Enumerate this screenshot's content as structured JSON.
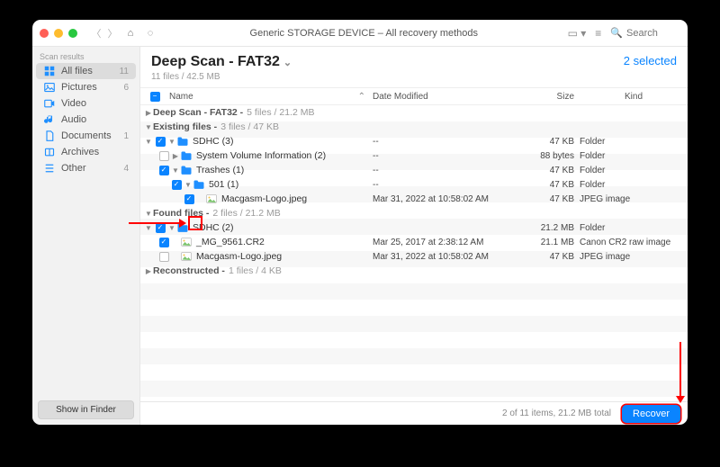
{
  "toolbar": {
    "title": "Generic STORAGE DEVICE – All recovery methods",
    "search_placeholder": "Search"
  },
  "sidebar": {
    "heading": "Scan results",
    "items": [
      {
        "label": "All files",
        "count": "11",
        "active": true,
        "icon": "grid"
      },
      {
        "label": "Pictures",
        "count": "6",
        "icon": "picture"
      },
      {
        "label": "Video",
        "count": "",
        "icon": "video"
      },
      {
        "label": "Audio",
        "count": "",
        "icon": "audio"
      },
      {
        "label": "Documents",
        "count": "1",
        "icon": "document"
      },
      {
        "label": "Archives",
        "count": "",
        "icon": "archive"
      },
      {
        "label": "Other",
        "count": "4",
        "icon": "other"
      }
    ],
    "footer_btn": "Show in Finder"
  },
  "main": {
    "title": "Deep Scan - FAT32",
    "subtitle": "11 files / 42.5 MB",
    "selected_label": "2 selected",
    "columns": {
      "name": "Name",
      "date": "Date Modified",
      "size": "Size",
      "kind": "Kind"
    },
    "footer_status": "2 of 11 items, 21.2 MB total",
    "recover_label": "Recover"
  },
  "groups": {
    "deep": {
      "label": "Deep Scan - FAT32 -",
      "meta": " 5 files / 21.2 MB"
    },
    "exist": {
      "label": "Existing files -",
      "meta": " 3 files / 47 KB"
    },
    "found": {
      "label": "Found files -",
      "meta": " 2 files / 21.2 MB"
    },
    "recon": {
      "label": "Reconstructed -",
      "meta": " 1 files / 4 KB"
    }
  },
  "rows": {
    "sdhc3": {
      "name": "SDHC (3)",
      "date": "--",
      "size": "47 KB",
      "kind": "Folder"
    },
    "svi": {
      "name": "System Volume Information (2)",
      "date": "--",
      "size": "88 bytes",
      "kind": "Folder"
    },
    "trashes": {
      "name": "Trashes (1)",
      "date": "--",
      "size": "47 KB",
      "kind": "Folder"
    },
    "501": {
      "name": "501 (1)",
      "date": "--",
      "size": "47 KB",
      "kind": "Folder"
    },
    "mg1": {
      "name": "Macgasm-Logo.jpeg",
      "date": "Mar 31, 2022 at 10:58:02 AM",
      "size": "47 KB",
      "kind": "JPEG image"
    },
    "sdhc2": {
      "name": "SDHC (2)",
      "date": "",
      "size": "21.2 MB",
      "kind": "Folder"
    },
    "cr2": {
      "name": "_MG_9561.CR2",
      "date": "Mar 25, 2017 at 2:38:12 AM",
      "size": "21.1 MB",
      "kind": "Canon CR2 raw image"
    },
    "mg2": {
      "name": "Macgasm-Logo.jpeg",
      "date": "Mar 31, 2022 at 10:58:02 AM",
      "size": "47 KB",
      "kind": "JPEG image"
    }
  }
}
